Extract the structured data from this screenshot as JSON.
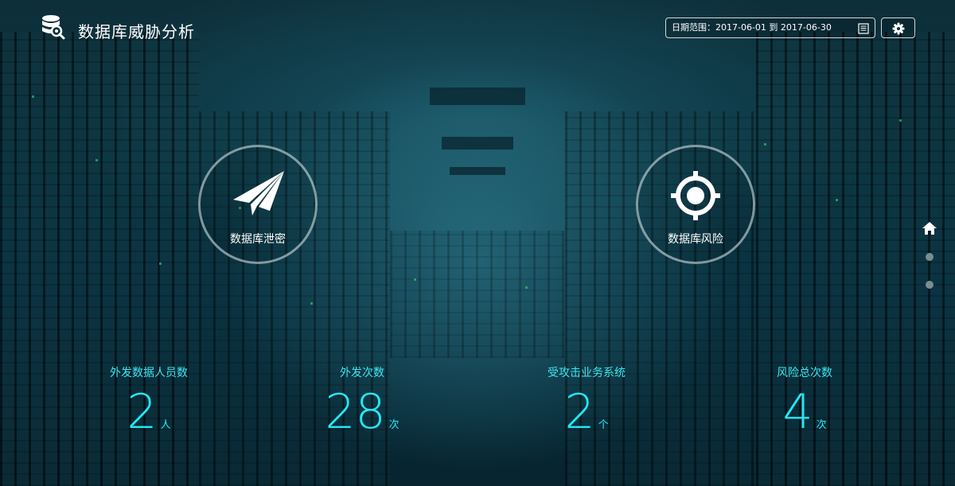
{
  "header": {
    "title": "数据库威胁分析",
    "date_range_text": "日期范围：2017-06-01 到 2017-06-30",
    "logo_icon": "database-search-icon",
    "calendar_icon": "list-calendar-icon",
    "settings_icon": "gear-icon"
  },
  "modules": [
    {
      "label": "数据库泄密",
      "icon": "paper-plane-icon"
    },
    {
      "label": "数据库风险",
      "icon": "target-icon"
    }
  ],
  "side_nav": {
    "home_icon": "home-icon",
    "dots": 2
  },
  "stats": [
    {
      "label": "外发数据人员数",
      "value": "2",
      "unit": "人"
    },
    {
      "label": "外发次数",
      "value": "28",
      "unit": "次"
    },
    {
      "label": "受攻击业务系统",
      "value": "2",
      "unit": "个"
    },
    {
      "label": "风险总次数",
      "value": "4",
      "unit": "次"
    }
  ],
  "colors": {
    "accent": "#23e8f5",
    "label": "#3ee5f0",
    "background": "#0a3340"
  }
}
